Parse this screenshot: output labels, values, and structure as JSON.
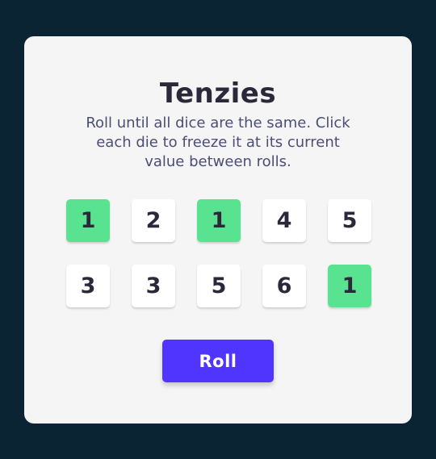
{
  "game": {
    "title": "Tenzies",
    "instructions": "Roll until all dice are the same. Click each die to freeze it at its current value between rolls.",
    "roll_label": "Roll",
    "dice": [
      {
        "value": "1",
        "held": true
      },
      {
        "value": "2",
        "held": false
      },
      {
        "value": "1",
        "held": true
      },
      {
        "value": "4",
        "held": false
      },
      {
        "value": "5",
        "held": false
      },
      {
        "value": "3",
        "held": false
      },
      {
        "value": "3",
        "held": false
      },
      {
        "value": "5",
        "held": false
      },
      {
        "value": "6",
        "held": false
      },
      {
        "value": "1",
        "held": true
      }
    ]
  },
  "colors": {
    "page_background": "#0b2434",
    "card_background": "#f5f5f5",
    "held_die": "#59e391",
    "die": "#ffffff",
    "roll_button": "#5035ff",
    "title_text": "#2b283a",
    "instructions_text": "#4a4e74"
  }
}
